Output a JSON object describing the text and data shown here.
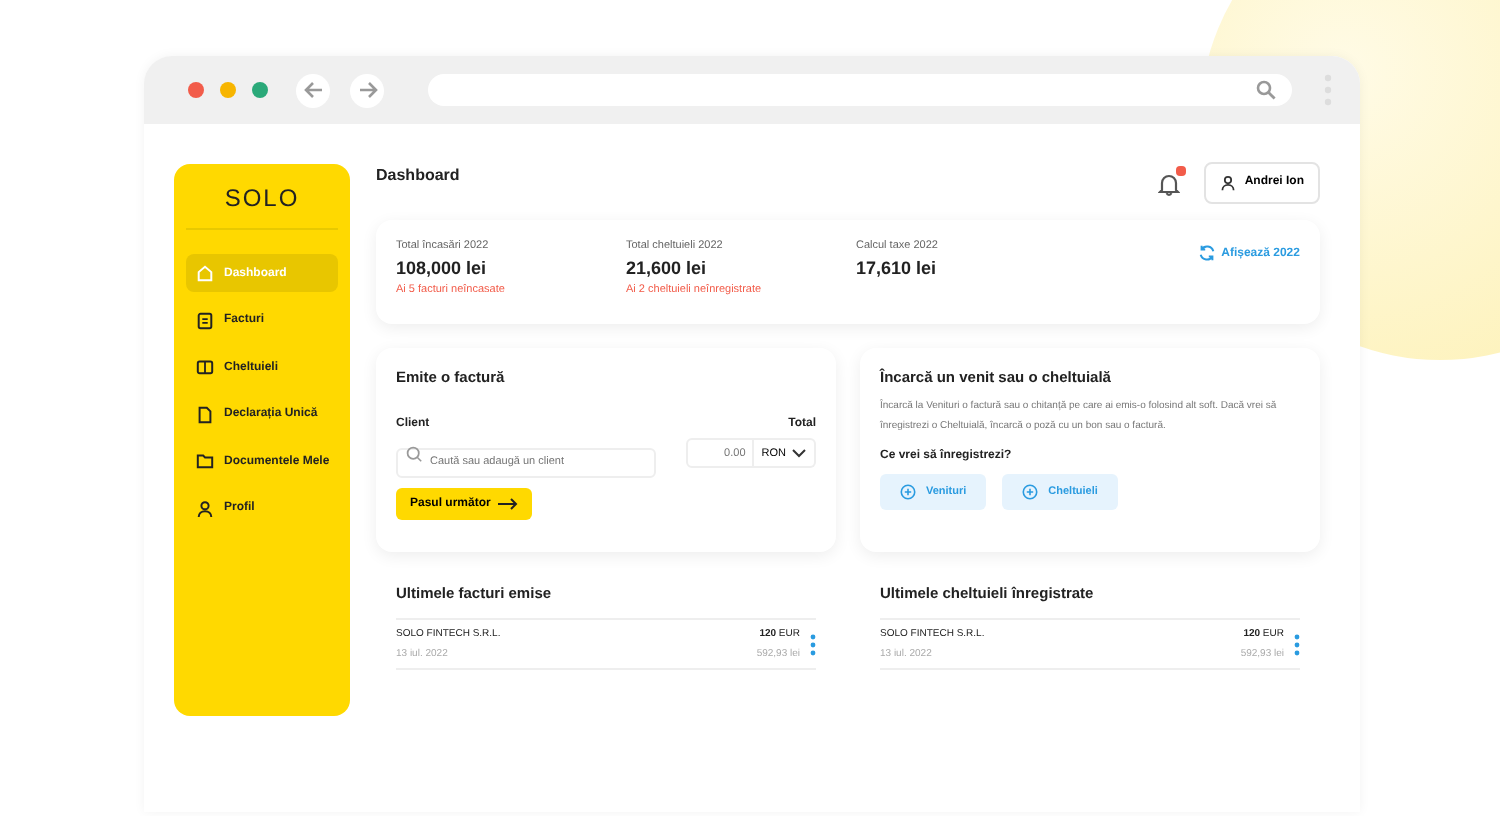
{
  "sidebar": {
    "logo": "SOLO",
    "items": [
      {
        "label": "Dashboard",
        "selected": true
      },
      {
        "label": "Facturi",
        "selected": false
      },
      {
        "label": "Cheltuieli",
        "selected": false
      },
      {
        "label": "Declarația Unică",
        "selected": false
      },
      {
        "label": "Documentele Mele",
        "selected": false
      },
      {
        "label": "Profil",
        "selected": false
      }
    ]
  },
  "header": {
    "title": "Dashboard",
    "notifications": true,
    "user": "Andrei Ion"
  },
  "stats": {
    "items": [
      {
        "label": "Total încasări 2022",
        "value": "108,000 lei",
        "note": "Ai 5 facturi neîncasate"
      },
      {
        "label": "Total cheltuieli 2022",
        "value": "21,600 lei",
        "note": "Ai 2 cheltuieli neînregistrate"
      },
      {
        "label": "Calcul taxe 2022",
        "value": "17,610 lei"
      }
    ],
    "action": "Afișează 2022"
  },
  "invoice_form": {
    "title": "Emite o factură",
    "client_label": "Client",
    "total_label": "Total",
    "client_placeholder": "Caută sau adaugă un client",
    "amount_placeholder": "0.00",
    "currency": "RON",
    "button": "Pasul următor"
  },
  "upload": {
    "title": "Încarcă un venit sau o cheltuială",
    "description": "Încarcă la Venituri o factură sau o chitanță pe care ai emis-o folosind alt soft. Dacă vrei să înregistrezi o Cheltuială, încarcă o poză cu un bon sau o factură.",
    "question": "Ce vrei să înregistrezi?",
    "buttons": [
      "Venituri",
      "Cheltuieli"
    ]
  },
  "lists": [
    {
      "title": "Ultimele facturi emise",
      "rows": [
        {
          "name": "SOLO FINTECH S.R.L.",
          "date": "13 iul. 2022",
          "amount": "**120** EUR",
          "converted": "592,93 lei"
        }
      ]
    },
    {
      "title": "Ultimele cheltuieli înregistrate",
      "rows": [
        {
          "name": "SOLO FINTECH S.R.L.",
          "date": "13 iul. 2022",
          "amount": "**120** EUR",
          "converted": "592,93 lei"
        }
      ]
    }
  ]
}
